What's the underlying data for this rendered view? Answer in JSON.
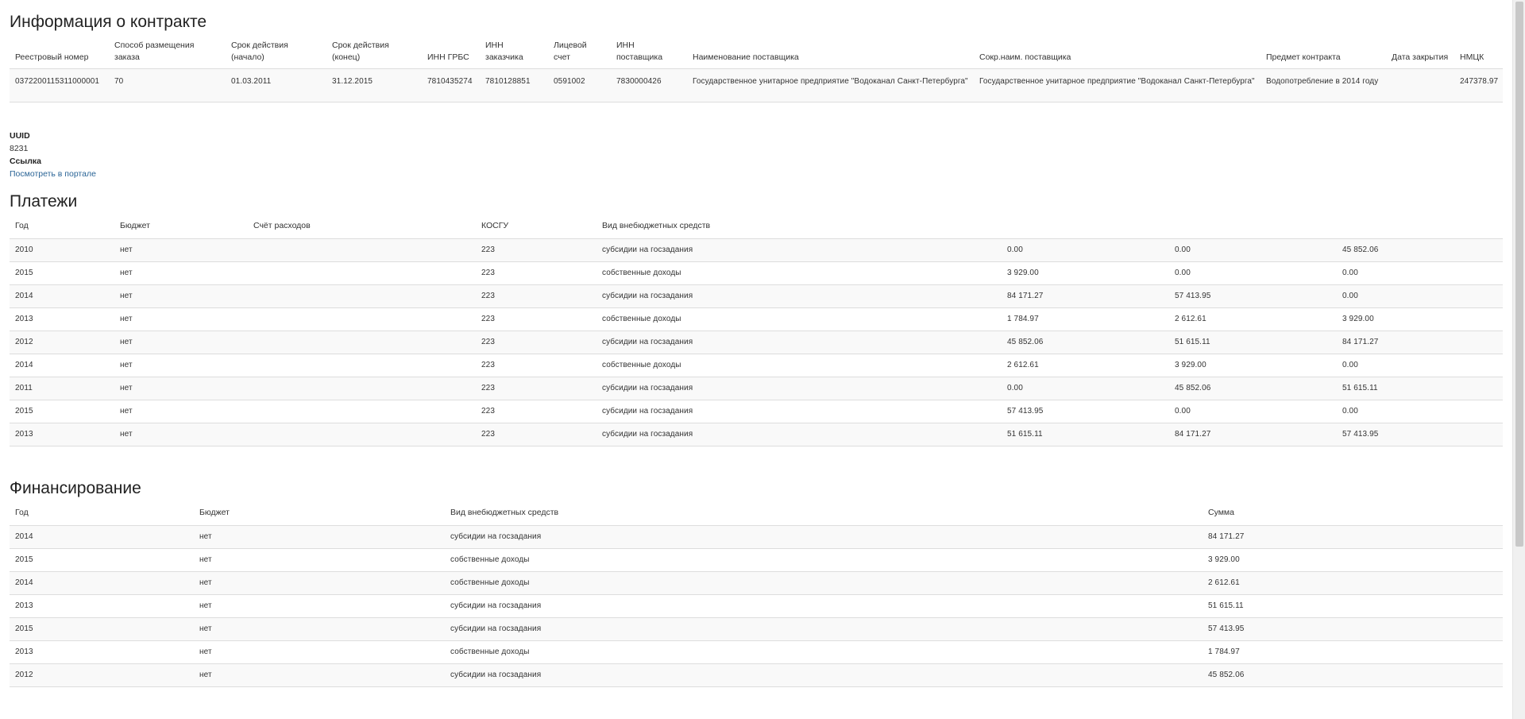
{
  "contract": {
    "title": "Информация о контракте",
    "headers": [
      "Реестровый номер",
      "Способ размещения заказа",
      "Срок действия (начало)",
      "Срок действия (конец)",
      "ИНН ГРБС",
      "ИНН заказчика",
      "Лицевой счет",
      "ИНН поставщика",
      "Наименование поставщика",
      "Сокр.наим. поставщика",
      "Предмет контракта",
      "Дата закрытия",
      "НМЦК"
    ],
    "row": [
      "0372200115311000001",
      "70",
      "01.03.2011",
      "31.12.2015",
      "7810435274",
      "7810128851",
      "0591002",
      "7830000426",
      "Государственное унитарное предприятие \"Водоканал Санкт-Петербурга\"",
      "Государственное унитарное предприятие \"Водоканал Санкт-Петербурга\"",
      "Водопотребление в 2014 году",
      "",
      "247378.97"
    ]
  },
  "meta": {
    "uuid_label": "UUID",
    "uuid_value": "8231",
    "link_label": "Ссылка",
    "link_text": "Посмотреть в портале"
  },
  "payments": {
    "title": "Платежи",
    "headers": [
      "Год",
      "Бюджет",
      "Счёт расходов",
      "КОСГУ",
      "Вид внебюджетных средств",
      "",
      "",
      ""
    ],
    "rows": [
      [
        "2010",
        "нет",
        "",
        "223",
        "субсидии на госзадания",
        "0.00",
        "0.00",
        "45 852.06"
      ],
      [
        "2015",
        "нет",
        "",
        "223",
        "собственные доходы",
        "3 929.00",
        "0.00",
        "0.00"
      ],
      [
        "2014",
        "нет",
        "",
        "223",
        "субсидии на госзадания",
        "84 171.27",
        "57 413.95",
        "0.00"
      ],
      [
        "2013",
        "нет",
        "",
        "223",
        "собственные доходы",
        "1 784.97",
        "2 612.61",
        "3 929.00"
      ],
      [
        "2012",
        "нет",
        "",
        "223",
        "субсидии на госзадания",
        "45 852.06",
        "51 615.11",
        "84 171.27"
      ],
      [
        "2014",
        "нет",
        "",
        "223",
        "собственные доходы",
        "2 612.61",
        "3 929.00",
        "0.00"
      ],
      [
        "2011",
        "нет",
        "",
        "223",
        "субсидии на госзадания",
        "0.00",
        "45 852.06",
        "51 615.11"
      ],
      [
        "2015",
        "нет",
        "",
        "223",
        "субсидии на госзадания",
        "57 413.95",
        "0.00",
        "0.00"
      ],
      [
        "2013",
        "нет",
        "",
        "223",
        "субсидии на госзадания",
        "51 615.11",
        "84 171.27",
        "57 413.95"
      ]
    ]
  },
  "financing": {
    "title": "Финансирование",
    "headers": [
      "Год",
      "Бюджет",
      "Вид внебюджетных средств",
      "Сумма"
    ],
    "rows": [
      [
        "2014",
        "нет",
        "субсидии на госзадания",
        "84 171.27"
      ],
      [
        "2015",
        "нет",
        "собственные доходы",
        "3 929.00"
      ],
      [
        "2014",
        "нет",
        "собственные доходы",
        "2 612.61"
      ],
      [
        "2013",
        "нет",
        "субсидии на госзадания",
        "51 615.11"
      ],
      [
        "2015",
        "нет",
        "субсидии на госзадания",
        "57 413.95"
      ],
      [
        "2013",
        "нет",
        "собственные доходы",
        "1 784.97"
      ],
      [
        "2012",
        "нет",
        "субсидии на госзадания",
        "45 852.06"
      ]
    ]
  }
}
